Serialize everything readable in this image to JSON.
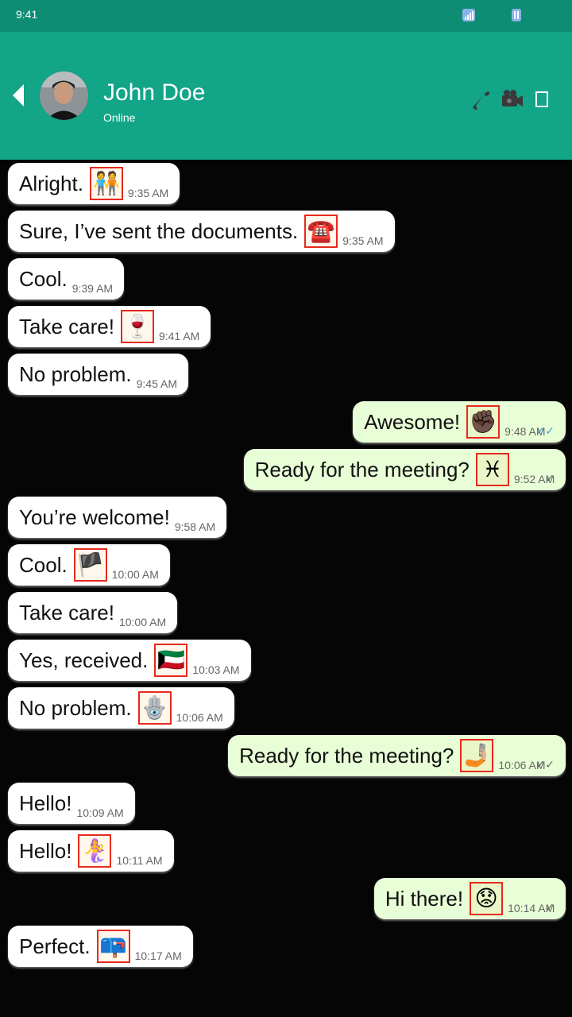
{
  "status_bar": {
    "time": "9:41",
    "signal_icon": "signal-icon",
    "battery_icon": "battery-icon"
  },
  "header": {
    "contact_name": "John Doe",
    "contact_status": "Online",
    "back_icon": "back-arrow-icon",
    "call_icon": "phone-icon",
    "video_icon": "video-camera-icon",
    "menu_icon": "menu-icon"
  },
  "messages": [
    {
      "dir": "in",
      "text": "Alright.",
      "emoji": "🧑‍🤝‍🧑",
      "emoji_name": "people-holding-hands-emoji",
      "time": "9:35 AM"
    },
    {
      "dir": "in",
      "text": "Sure, I’ve sent the documents.",
      "emoji": "☎️",
      "emoji_name": "telephone-emoji",
      "time": "9:35 AM"
    },
    {
      "dir": "in",
      "text": "Cool.",
      "emoji": "",
      "emoji_name": "",
      "time": "9:39 AM"
    },
    {
      "dir": "in",
      "text": "Take care!",
      "emoji": "🍷",
      "emoji_name": "wine-glass-emoji",
      "time": "9:41 AM"
    },
    {
      "dir": "in",
      "text": "No problem.",
      "emoji": "",
      "emoji_name": "",
      "time": "9:45 AM"
    },
    {
      "dir": "out",
      "text": "Awesome!",
      "emoji": "✊🏿",
      "emoji_name": "raised-fist-emoji",
      "time": "9:48 AM",
      "status": "read"
    },
    {
      "dir": "out",
      "text": "Ready for the meeting?",
      "emoji": "♓",
      "emoji_name": "pisces-emoji",
      "time": "9:52 AM",
      "status": "sent"
    },
    {
      "dir": "in",
      "text": "You’re welcome!",
      "emoji": "",
      "emoji_name": "",
      "time": "9:58 AM"
    },
    {
      "dir": "in",
      "text": "Cool.",
      "emoji": "🏴",
      "emoji_name": "flag-emoji",
      "time": "10:00 AM"
    },
    {
      "dir": "in",
      "text": "Take care!",
      "emoji": "",
      "emoji_name": "",
      "time": "10:00 AM"
    },
    {
      "dir": "in",
      "text": "Yes, received.",
      "emoji": "🇰🇼",
      "emoji_name": "kuwait-flag-emoji",
      "time": "10:03 AM"
    },
    {
      "dir": "in",
      "text": "No problem.",
      "emoji": "🪬",
      "emoji_name": "hamsa-emoji",
      "time": "10:06 AM"
    },
    {
      "dir": "out",
      "text": "Ready for the meeting?",
      "emoji": "🤳🏼",
      "emoji_name": "selfie-emoji",
      "time": "10:06 AM",
      "status": "delivered"
    },
    {
      "dir": "in",
      "text": "Hello!",
      "emoji": "",
      "emoji_name": "",
      "time": "10:09 AM"
    },
    {
      "dir": "in",
      "text": "Hello!",
      "emoji": "🧜‍♀️",
      "emoji_name": "mermaid-emoji",
      "time": "10:11 AM"
    },
    {
      "dir": "out",
      "text": "Hi there!",
      "emoji": "😟",
      "emoji_name": "worried-face-emoji",
      "time": "10:14 AM",
      "status": "sent"
    },
    {
      "dir": "in",
      "text": "Perfect.",
      "emoji": "📪",
      "emoji_name": "mailbox-emoji",
      "time": "10:17 AM"
    }
  ]
}
